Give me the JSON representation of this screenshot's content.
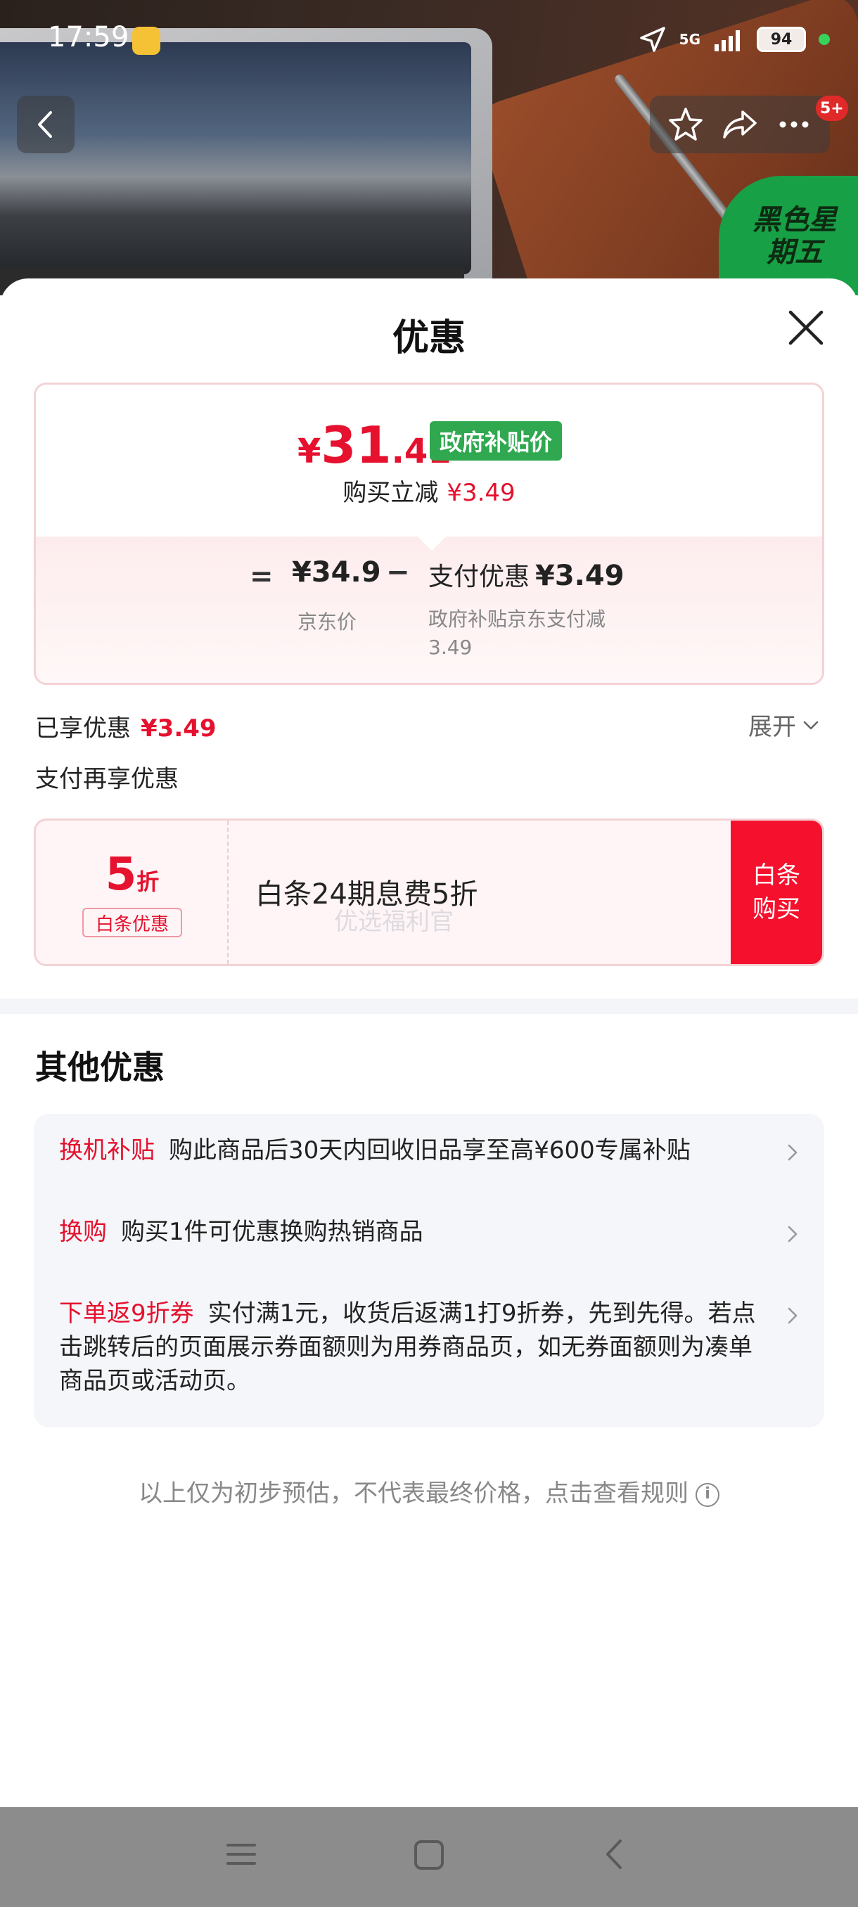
{
  "status_bar": {
    "time": "17:59",
    "network": "5G",
    "battery": "94"
  },
  "top_nav": {
    "cart_badge": "5+"
  },
  "promo_badge": {
    "text": "黑色星期五"
  },
  "sheet": {
    "title": "优惠",
    "price_card": {
      "currency": "¥",
      "price_int": "31",
      "price_dec": ".41",
      "gov_tag": "政府补贴价",
      "reduce_label": "购买立减",
      "reduce_value": "¥3.49",
      "eq_sign": "=",
      "jd_price": "¥34.9",
      "jd_label": "京东价",
      "minus_sign": "−",
      "pay_disc_label": "支付优惠",
      "pay_disc_value": "¥3.49",
      "pay_desc": "政府补贴京东支付减3.49"
    },
    "enjoyed_label": "已享优惠",
    "enjoyed_value": "¥3.49",
    "expand_label": "展开",
    "pay_more_label": "支付再享优惠",
    "baitiao": {
      "discount_num": "5",
      "discount_unit": "折",
      "tag": "白条优惠",
      "title": "白条24期息费5折",
      "watermark": "优选福利官",
      "buy_label_line1": "白条",
      "buy_label_line2": "购买"
    },
    "other": {
      "title": "其他优惠",
      "items": [
        {
          "tag": "换机补贴",
          "text": "购此商品后30天内回收旧品享至高¥600专属补贴"
        },
        {
          "tag": "换购",
          "text": "购买1件可优惠换购热销商品"
        },
        {
          "tag": "下单返9折券",
          "text": "实付满1元，收货后返满1打9折券，先到先得。若点击跳转后的页面展示券面额则为用券商品页，如无券面额则为凑单商品页或活动页。"
        }
      ]
    },
    "footer_note": "以上仅为初步预估，不代表最终价格，点击查看规则"
  }
}
